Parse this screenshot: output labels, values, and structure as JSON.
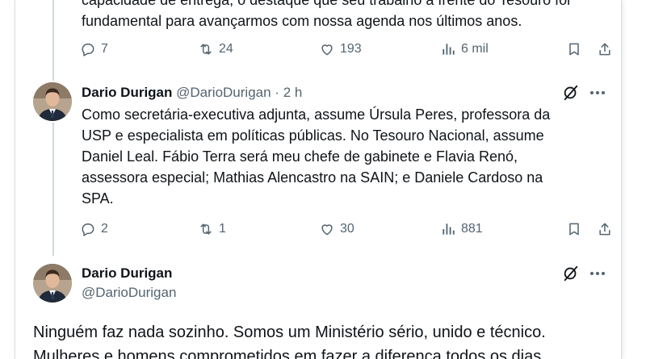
{
  "tweet1": {
    "text_top": "capacidade de entrega, o destaque que seu trabalho à frente do Tesouro foi",
    "text_bottom": "fundamental para avançarmos com nossa agenda nos últimos anos.",
    "replies": "7",
    "reposts": "24",
    "likes": "193",
    "views": "6 mil"
  },
  "tweet2": {
    "name": "Dario Durigan",
    "handle": "@DarioDurigan",
    "separator": "·",
    "time": "2 h",
    "lines": [
      "Como secretária-executiva adjunta, assume Úrsula Peres, professora da",
      "USP e especialista em políticas públicas. No Tesouro Nacional, assume",
      "Daniel Leal. Fábio Terra será meu chefe de gabinete e Flavia Renó,",
      "assessora especial; Mathias Alencastro na SAIN; e Daniele Cardoso na",
      "SPA."
    ],
    "replies": "2",
    "reposts": "1",
    "likes": "30",
    "views": "881"
  },
  "tweet3": {
    "name": "Dario Durigan",
    "handle": "@DarioDurigan",
    "lines": [
      "Ninguém faz nada sozinho. Somos um Ministério sério, unido e técnico.",
      "Mulheres e homens comprometidos em fazer a diferença todos os dias."
    ]
  },
  "colors": {
    "text": "#0f1419",
    "secondary": "#536471",
    "thread_line": "#cfd9de"
  },
  "icons": [
    "reply-icon",
    "repost-icon",
    "like-icon",
    "views-icon",
    "bookmark-icon",
    "share-icon",
    "grok-icon",
    "more-icon"
  ]
}
